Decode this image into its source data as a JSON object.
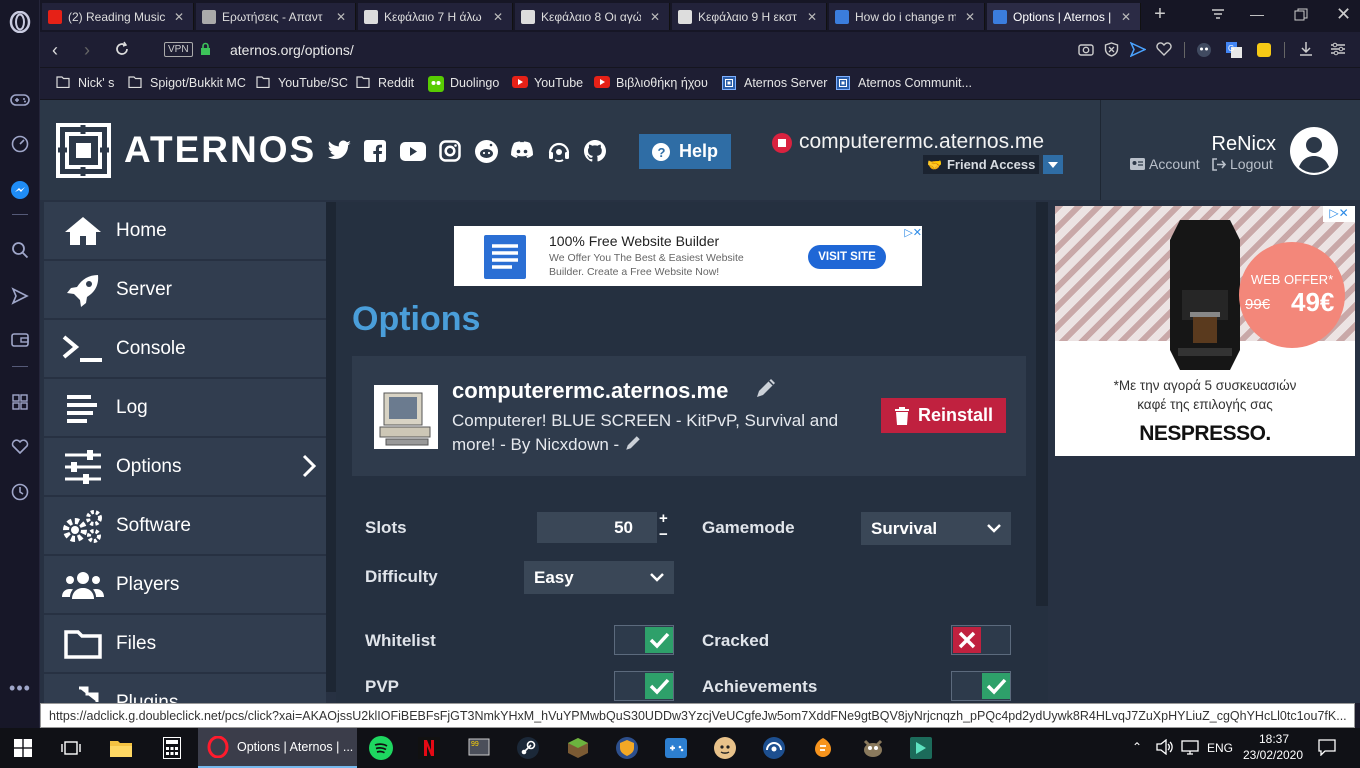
{
  "browser": {
    "tabs": [
      {
        "title": "(2) Reading Music t",
        "color": "#e62117"
      },
      {
        "title": "Ερωτήσεις - Απαντ",
        "color": "#aaaaaa"
      },
      {
        "title": "Κεφάλαιο 7 Η άλω",
        "color": "#dddddd"
      },
      {
        "title": "Κεφάλαιο 8 Οι αγώ",
        "color": "#dddddd"
      },
      {
        "title": "Κεφάλαιο 9 Η εκστ",
        "color": "#dddddd"
      },
      {
        "title": "How do i change m",
        "color": "#3b7ddd"
      },
      {
        "title": "Options | Aternos |",
        "color": "#3b7ddd",
        "active": true
      }
    ],
    "vpn_label": "VPN",
    "url": "aternos.org/options/",
    "bookmarks": [
      {
        "label": "Nick' s",
        "icon": "folder-icon"
      },
      {
        "label": "Spigot/Bukkit MC",
        "icon": "folder-icon"
      },
      {
        "label": "YouTube/SC",
        "icon": "folder-icon"
      },
      {
        "label": "Reddit",
        "icon": "folder-icon"
      },
      {
        "label": "Duolingo",
        "icon": "duolingo-icon"
      },
      {
        "label": "YouTube",
        "icon": "youtube-icon"
      },
      {
        "label": "Βιβλιοθήκη ήχου",
        "icon": "youtube-icon"
      },
      {
        "label": "Aternos Server",
        "icon": "aternos-icon"
      },
      {
        "label": "Aternos Communit...",
        "icon": "aternos-icon"
      }
    ],
    "status_url": "https://adclick.g.doubleclick.net/pcs/click?xai=AKAOjssU2klIOFiBEBFsFjGT3NmkYHxM_hVuYPMwbQuS30UDDw3YzcjVeUCgfeJw5om7XddFNe9gtBQV8jyNrjcnqzh_pPQc4pd2ydUywk8R4HLvqJ7ZuXpHYLiuZ_cgQhYHcLl0tc1ou7fK..."
  },
  "header": {
    "brand": "ATERNOS",
    "help_label": "Help",
    "server_address": "computerermc.aternos.me",
    "friend_access_label": "Friend Access",
    "username": "ReNicx",
    "account_label": "Account",
    "logout_label": "Logout"
  },
  "nav": [
    {
      "label": "Home",
      "icon": "home-icon"
    },
    {
      "label": "Server",
      "icon": "rocket-icon"
    },
    {
      "label": "Console",
      "icon": "terminal-icon"
    },
    {
      "label": "Log",
      "icon": "log-icon"
    },
    {
      "label": "Options",
      "icon": "sliders-icon",
      "active": true
    },
    {
      "label": "Software",
      "icon": "gears-icon"
    },
    {
      "label": "Players",
      "icon": "users-icon"
    },
    {
      "label": "Files",
      "icon": "folder-icon"
    },
    {
      "label": "Plugins",
      "icon": "puzzle-icon"
    }
  ],
  "ad_top": {
    "title": "100% Free Website Builder",
    "line1": "We Offer You The Best & Easiest Website",
    "line2": "Builder. Create a Free Website Now!",
    "cta": "VISIT SITE"
  },
  "main": {
    "title": "Options",
    "server_name": "computerermc.aternos.me",
    "motd": "Computerer! BLUE SCREEN - KitPvP, Survival and more! - By Nicxdown -",
    "reinstall_label": "Reinstall",
    "slots_label": "Slots",
    "slots_value": "50",
    "gamemode_label": "Gamemode",
    "gamemode_value": "Survival",
    "difficulty_label": "Difficulty",
    "difficulty_value": "Easy",
    "toggles": [
      {
        "label": "Whitelist",
        "on": true
      },
      {
        "label": "Cracked",
        "on": false
      },
      {
        "label": "PVP",
        "on": true
      },
      {
        "label": "Achievements",
        "on": true
      }
    ]
  },
  "ad_side": {
    "offer_label": "WEB OFFER*",
    "old_price": "99€",
    "price": "49€",
    "text1": "*Με την αγορά 5 συσκευασιών",
    "text2": "καφέ της επιλογής σας",
    "brand": "NESPRESSO."
  },
  "taskbar": {
    "active_window": "Options | Aternos | ...",
    "language": "ENG",
    "time": "18:37",
    "date": "23/02/2020"
  },
  "colors": {
    "accent_blue": "#4a9eda",
    "reinstall_red": "#c0213f",
    "toggle_green": "#2ea06a",
    "toggle_red": "#c0213f",
    "header_bg": "#2c3848",
    "nav_bg": "#313d4f"
  }
}
